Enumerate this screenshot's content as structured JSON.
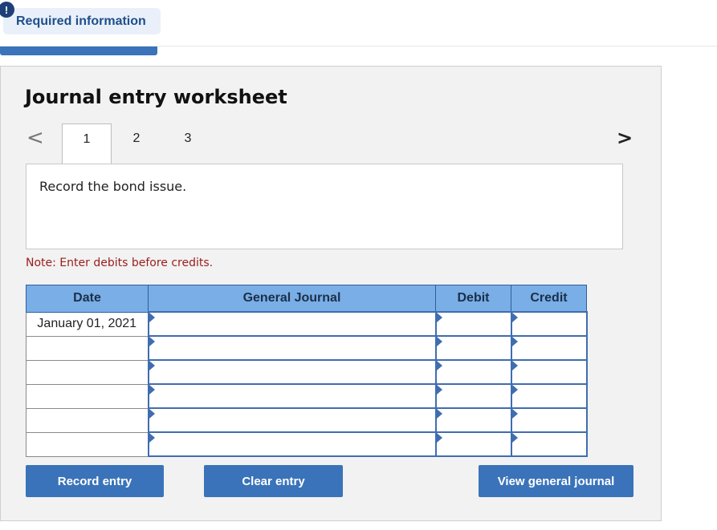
{
  "header": {
    "alert_symbol": "!",
    "required_label": "Required information"
  },
  "worksheet": {
    "title": "Journal entry worksheet",
    "nav_prev": "<",
    "nav_next": ">",
    "tabs": [
      {
        "label": "1",
        "active": true
      },
      {
        "label": "2",
        "active": false
      },
      {
        "label": "3",
        "active": false
      }
    ],
    "instruction": "Record the bond issue.",
    "note": "Note: Enter debits before credits."
  },
  "table": {
    "headers": {
      "date": "Date",
      "general_journal": "General Journal",
      "debit": "Debit",
      "credit": "Credit"
    },
    "rows": [
      {
        "date": "January 01, 2021",
        "account": "",
        "debit": "",
        "credit": ""
      },
      {
        "date": "",
        "account": "",
        "debit": "",
        "credit": ""
      },
      {
        "date": "",
        "account": "",
        "debit": "",
        "credit": ""
      },
      {
        "date": "",
        "account": "",
        "debit": "",
        "credit": ""
      },
      {
        "date": "",
        "account": "",
        "debit": "",
        "credit": ""
      },
      {
        "date": "",
        "account": "",
        "debit": "",
        "credit": ""
      }
    ]
  },
  "buttons": {
    "record": "Record entry",
    "clear": "Clear entry",
    "view": "View general journal"
  },
  "colors": {
    "accent": "#3a73b9",
    "header_bg": "#79aee6",
    "note": "#9b1c1c"
  }
}
